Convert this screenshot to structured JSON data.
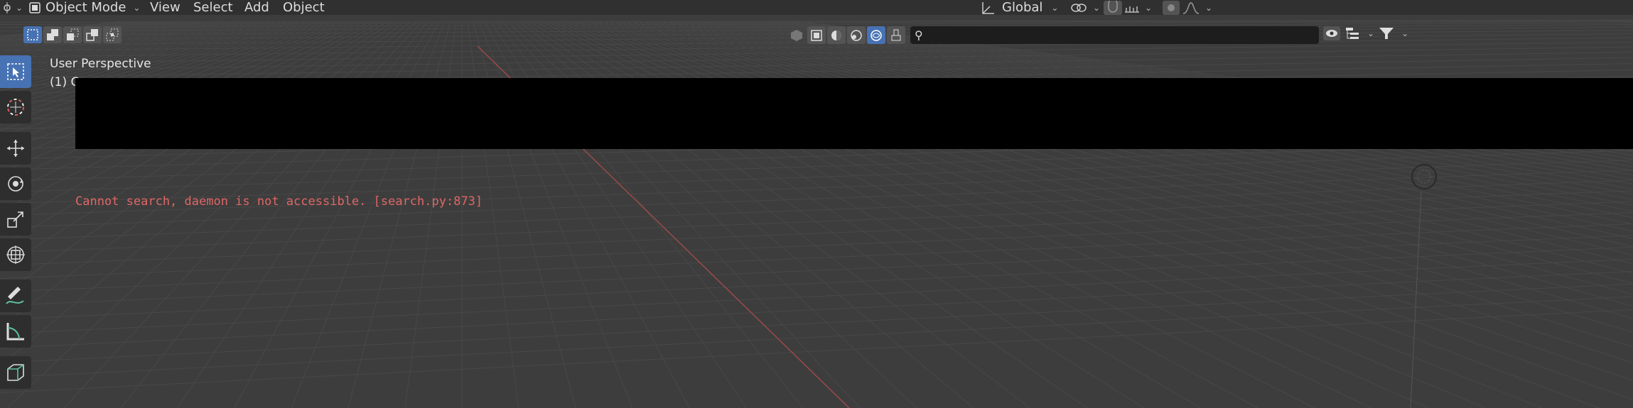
{
  "header": {
    "mode": "Object Mode",
    "menus": [
      "View",
      "Select",
      "Add",
      "Object"
    ],
    "orientation": "Global"
  },
  "search": {
    "value": "",
    "placeholder": ""
  },
  "viewport": {
    "perspective_label": "User Perspective",
    "collection_label": "(1) C",
    "error_message": "Cannot search, daemon is not accessible. [search.py:873]"
  },
  "colors": {
    "accent": "#4772b3",
    "error": "#e06666",
    "x_axis": "#b04a4a",
    "header_bg": "#303030",
    "viewport_bg": "#3d3d3d"
  },
  "icons": {
    "left_tools": [
      "select-box-icon",
      "cursor-icon",
      "move-icon",
      "rotate-icon",
      "scale-icon",
      "transform-icon",
      "annotate-icon",
      "measure-icon",
      "add-cube-icon"
    ]
  }
}
